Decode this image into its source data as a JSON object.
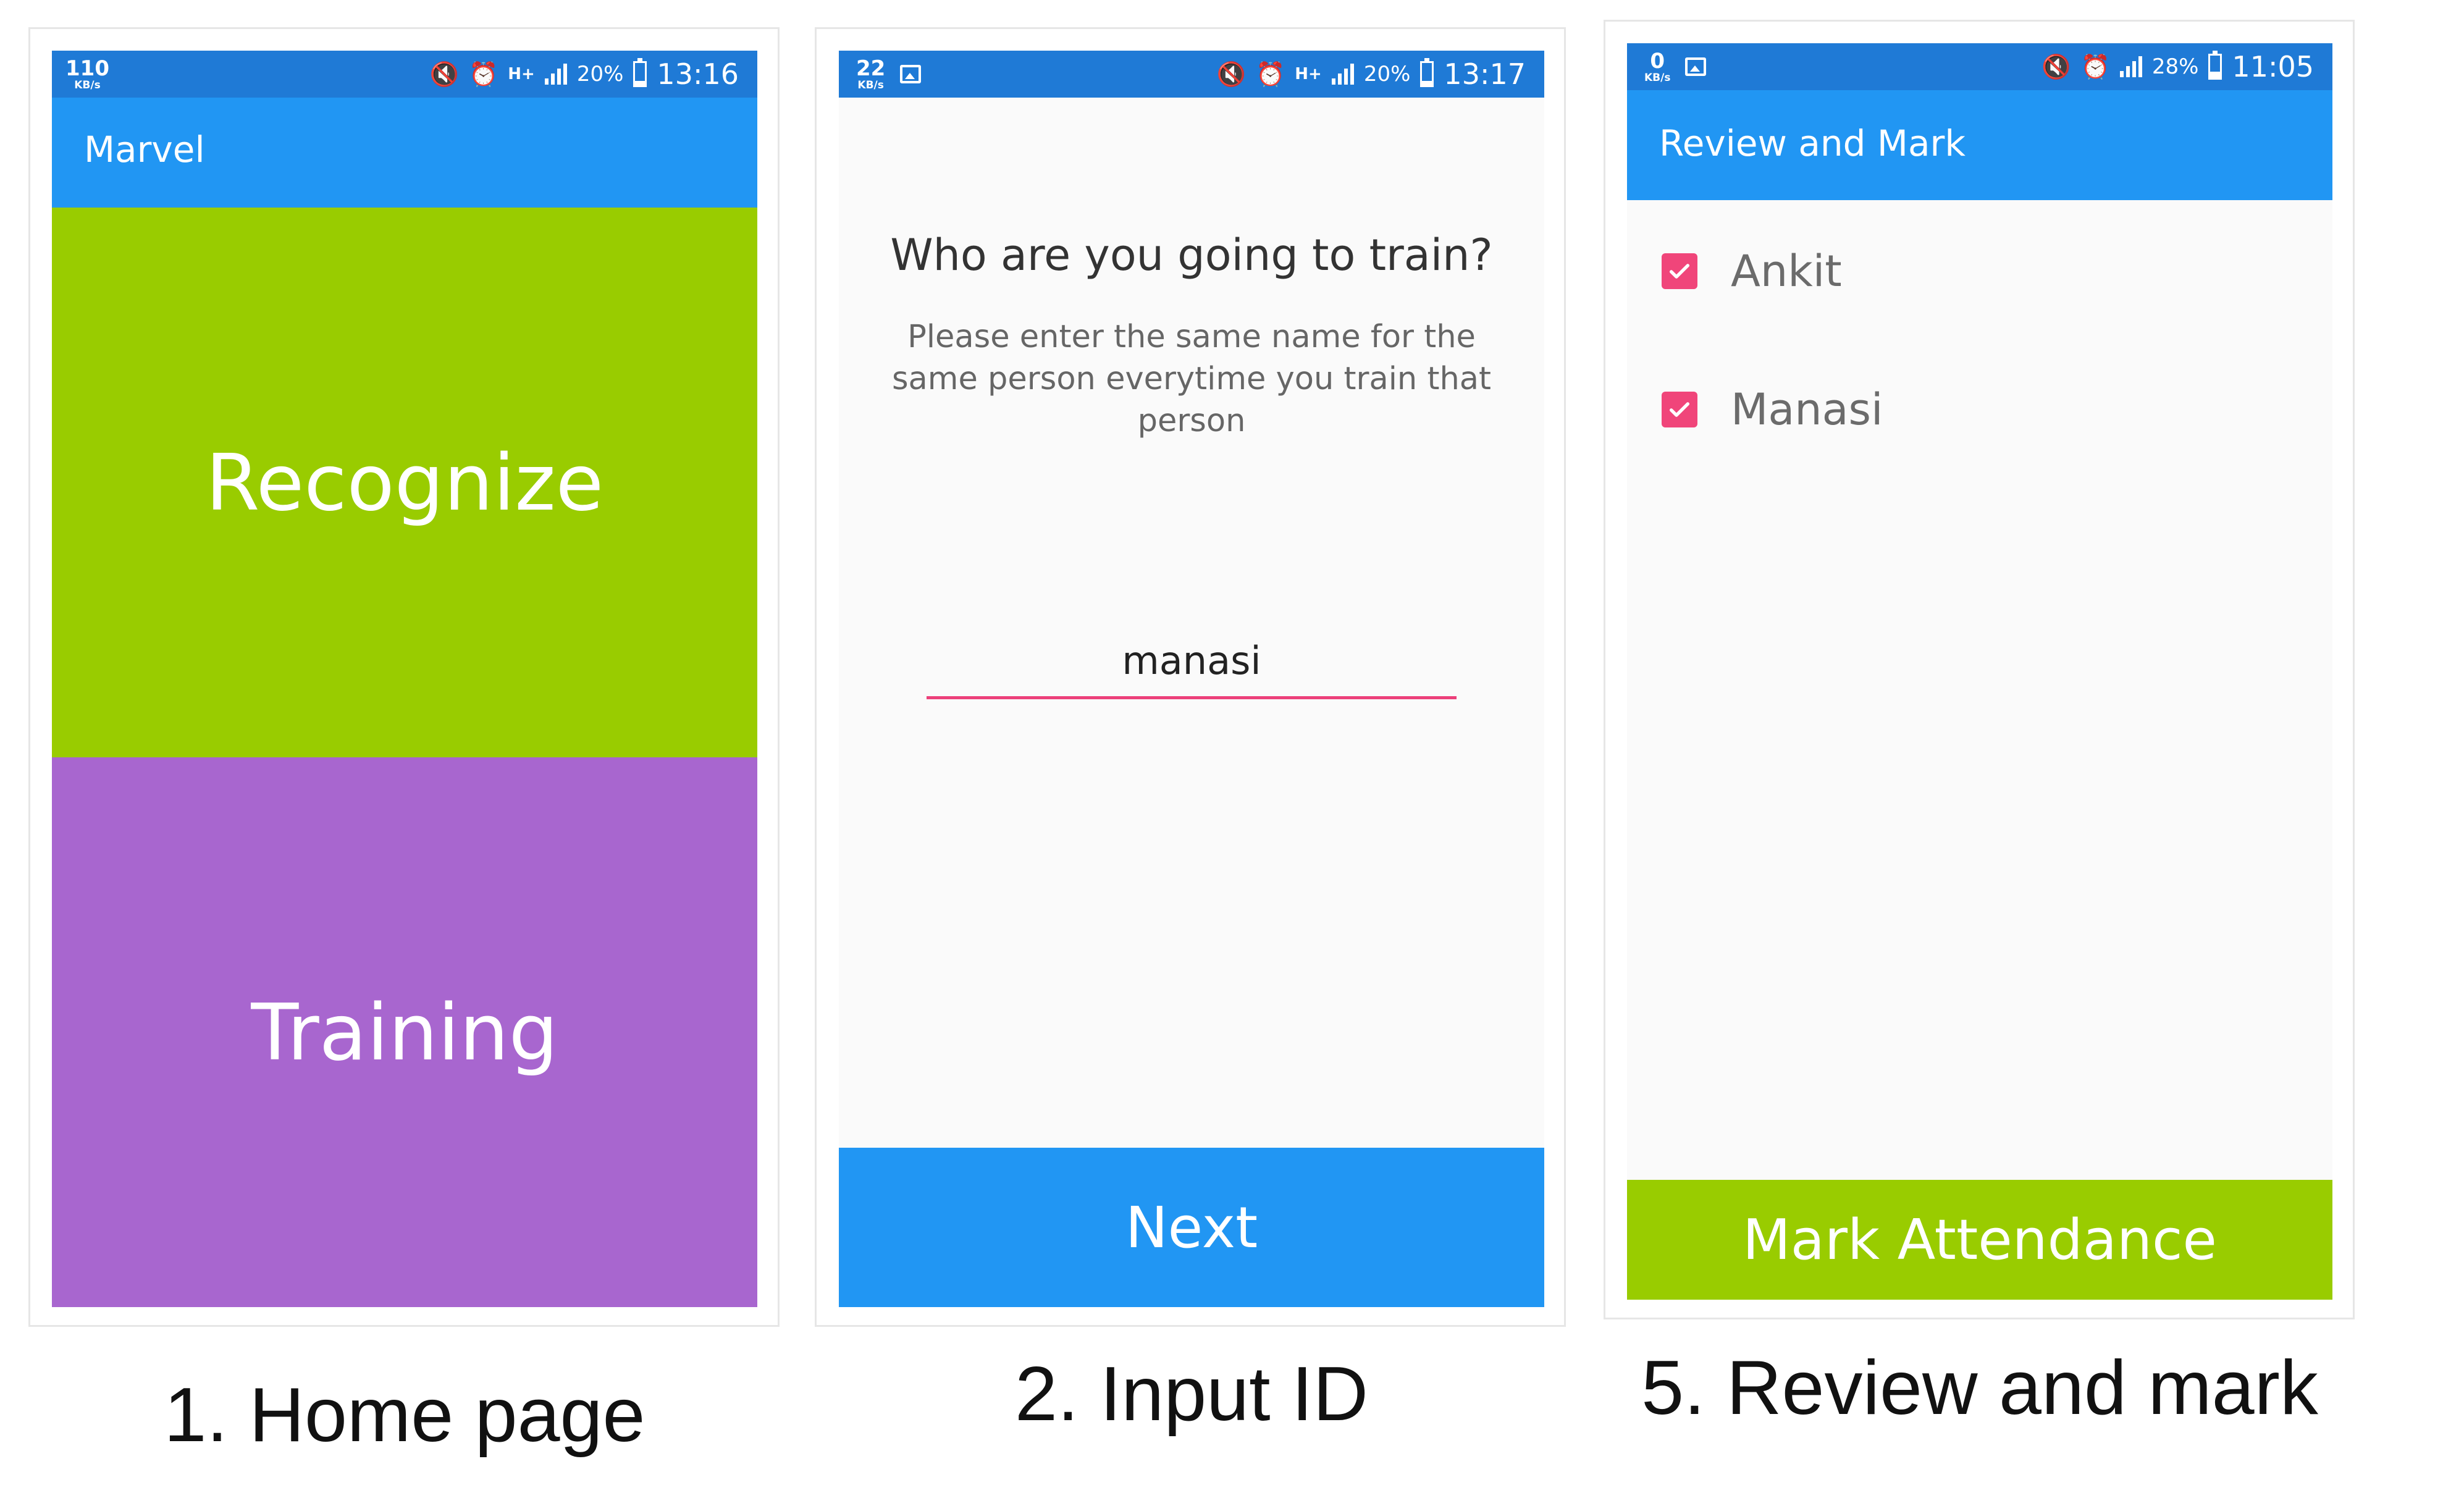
{
  "colors": {
    "status_bar": "#1f7ad6",
    "app_bar": "#2196f3",
    "recognize_tile": "#99cc00",
    "training_tile": "#a866cf",
    "next_button": "#2196f3",
    "mark_button": "#99cc00",
    "accent_pink": "#f0457a"
  },
  "screens": [
    {
      "status_bar": {
        "speed_value": "110",
        "speed_unit": "KB/s",
        "icons": [
          "mute-vibrate-icon",
          "alarm-icon",
          "hplus-data-icon",
          "signal-icon"
        ],
        "battery_pct": "20%",
        "battery_level": 0.2,
        "time": "13:16"
      },
      "app_bar_title": "Marvel",
      "tiles": [
        "Recognize",
        "Training"
      ],
      "caption": "1. Home page"
    },
    {
      "status_bar": {
        "speed_value": "22",
        "speed_unit": "KB/s",
        "icons": [
          "image-icon",
          "mute-vibrate-icon",
          "alarm-icon",
          "hplus-data-icon",
          "signal-icon"
        ],
        "battery_pct": "20%",
        "battery_level": 0.2,
        "time": "13:17"
      },
      "question": "Who are you going to train?",
      "hint": "Please enter the same name for the same person everytime you train that person",
      "name_value": "manasi",
      "button_label": "Next",
      "caption": "2. Input ID"
    },
    {
      "status_bar": {
        "speed_value": "0",
        "speed_unit": "KB/s",
        "icons": [
          "image-icon",
          "mute-vibrate-icon",
          "alarm-icon",
          "signal-icon"
        ],
        "battery_pct": "28%",
        "battery_level": 0.28,
        "time": "11:05"
      },
      "app_bar_title": "Review and Mark",
      "items": [
        {
          "label": "Ankit",
          "checked": true
        },
        {
          "label": "Manasi",
          "checked": true
        }
      ],
      "button_label": "Mark Attendance",
      "caption": "5. Review and mark"
    }
  ]
}
